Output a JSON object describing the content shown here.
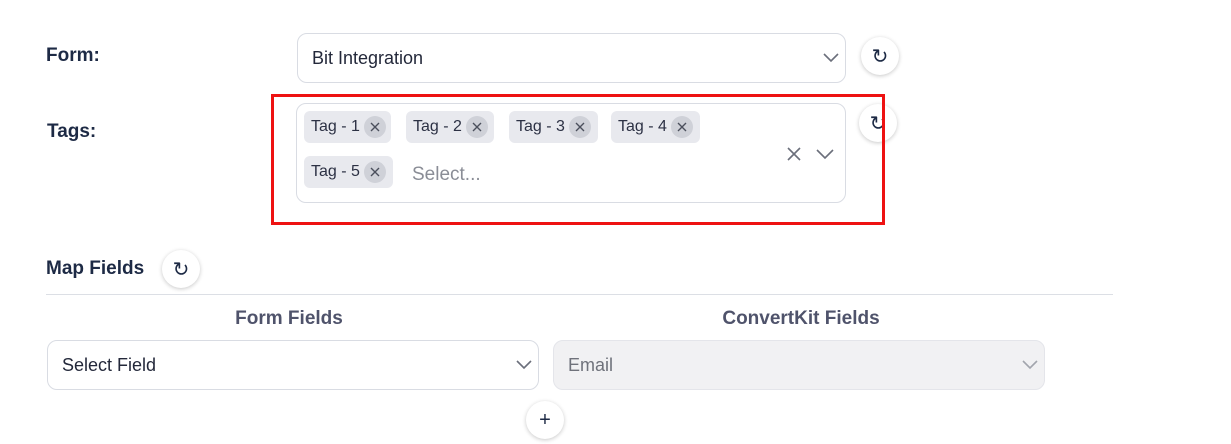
{
  "form": {
    "label": "Form:",
    "selected": "Bit Integration",
    "refresh_icon": "refresh-icon"
  },
  "tags": {
    "label": "Tags:",
    "items": [
      "Tag - 1",
      "Tag - 2",
      "Tag - 3",
      "Tag - 4",
      "Tag - 5"
    ],
    "placeholder": "Select...",
    "refresh_icon": "refresh-icon",
    "highlight_color": "#ee1212"
  },
  "map_fields": {
    "title": "Map Fields",
    "columns": [
      "Form Fields",
      "ConvertKit Fields"
    ],
    "rows": [
      {
        "form_field": "Select Field",
        "convertkit_field": "Email"
      }
    ],
    "add_label": "+"
  },
  "icons": {
    "refresh": "↻",
    "clear": "×"
  }
}
